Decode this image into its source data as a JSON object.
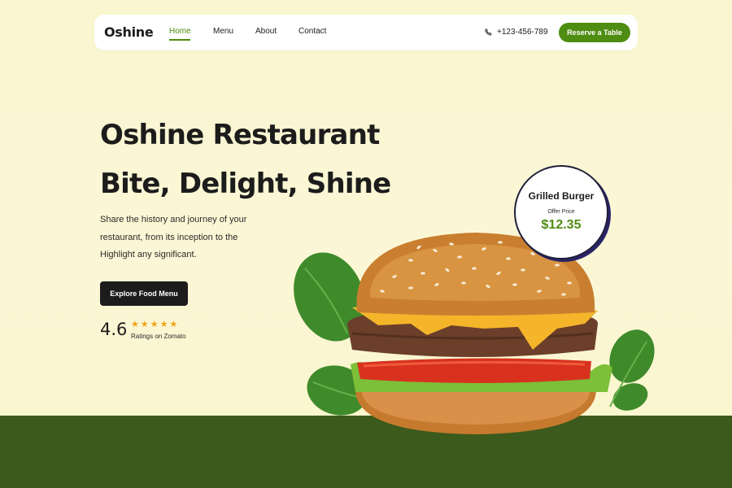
{
  "brand": {
    "name": "Oshine"
  },
  "nav": {
    "links": [
      {
        "label": "Home",
        "active": true
      },
      {
        "label": "Menu",
        "active": false
      },
      {
        "label": "About",
        "active": false
      },
      {
        "label": "Contact",
        "active": false
      }
    ],
    "phone": "+123-456-789",
    "phone_icon": "phone-icon",
    "reserve_label": "Reserve a Table"
  },
  "hero": {
    "title_line1": "Oshine Restaurant",
    "title_line2": "Bite, Delight, Shine",
    "description": "Share the history and journey of your restaurant, from its inception to the Highlight any significant.",
    "cta_label": "Explore Food Menu",
    "rating": {
      "value": "4.6",
      "stars": "★★★★★",
      "source": "Ratings on Zomato",
      "star_count": 5
    }
  },
  "offer": {
    "name": "Grilled Burger",
    "label": "Offer Price",
    "price": "$12.35"
  },
  "colors": {
    "accent": "#4f8c12",
    "background": "#faf6cf",
    "band": "#3b5a1c",
    "dark": "#1c1c1c",
    "star": "#f0a21a"
  }
}
